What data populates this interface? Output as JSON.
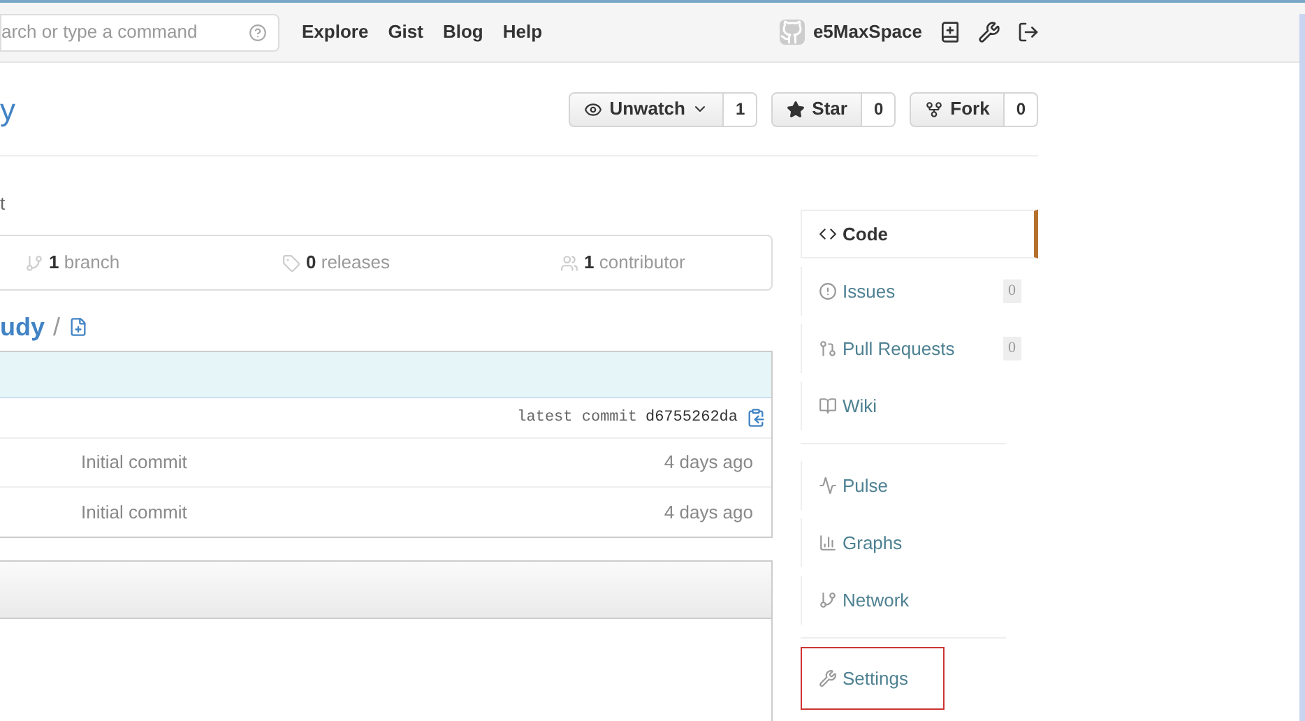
{
  "header": {
    "search": {
      "placeholder": "arch or type a command"
    },
    "nav": [
      "Explore",
      "Gist",
      "Blog",
      "Help"
    ],
    "user": "e5MaxSpace"
  },
  "repo": {
    "title": "y",
    "actions": [
      {
        "kind": "watch",
        "label": "Unwatch",
        "count": "1"
      },
      {
        "kind": "star",
        "label": "Star",
        "count": "0"
      },
      {
        "kind": "fork",
        "label": "Fork",
        "count": "0"
      }
    ]
  },
  "description": "t",
  "stats": [
    {
      "kind": "branch",
      "count": "1",
      "label": "branch"
    },
    {
      "kind": "release",
      "count": "0",
      "label": "releases"
    },
    {
      "kind": "contributor",
      "count": "1",
      "label": "contributor"
    }
  ],
  "breadcrumb": {
    "repo": "udy",
    "separator": "/"
  },
  "files": {
    "latest_commit_label": "latest commit",
    "commit_hash": "d6755262da",
    "rows": [
      {
        "message": "Initial commit",
        "age": "4 days ago"
      },
      {
        "message": "Initial commit",
        "age": "4 days ago"
      }
    ]
  },
  "sidebar": {
    "groups": [
      [
        {
          "kind": "code",
          "label": "Code",
          "selected": true,
          "highlighted": false
        },
        {
          "kind": "issues",
          "label": "Issues",
          "count": "0",
          "selected": false,
          "highlighted": false
        },
        {
          "kind": "pulls",
          "label": "Pull Requests",
          "count": "0",
          "selected": false,
          "highlighted": false
        },
        {
          "kind": "wiki",
          "label": "Wiki",
          "selected": false,
          "highlighted": false
        }
      ],
      [
        {
          "kind": "pulse",
          "label": "Pulse",
          "selected": false,
          "highlighted": false
        },
        {
          "kind": "graphs",
          "label": "Graphs",
          "selected": false,
          "highlighted": false
        },
        {
          "kind": "network",
          "label": "Network",
          "selected": false,
          "highlighted": false
        }
      ],
      [
        {
          "kind": "settings",
          "label": "Settings",
          "selected": false,
          "highlighted": true
        }
      ]
    ]
  }
}
